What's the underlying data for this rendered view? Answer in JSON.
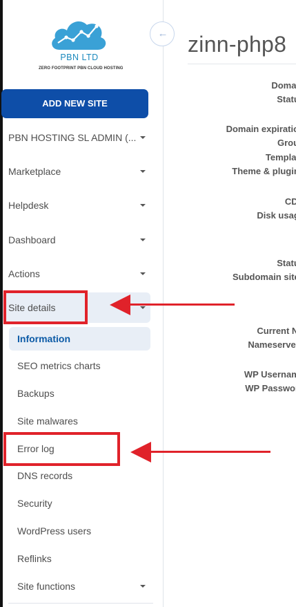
{
  "logo": {
    "title": "PBN LTD",
    "tagline": "ZERO FOOTPRINT PBN CLOUD HOSTING"
  },
  "sidebar": {
    "add_button": "ADD NEW SITE",
    "menu": [
      {
        "label": "PBN HOSTING SL ADMIN (..."
      },
      {
        "label": "Marketplace"
      },
      {
        "label": "Helpdesk"
      },
      {
        "label": "Dashboard"
      },
      {
        "label": "Actions"
      },
      {
        "label": "Site details"
      }
    ],
    "sub_menu": [
      {
        "label": "Information"
      },
      {
        "label": "SEO metrics charts"
      },
      {
        "label": "Backups"
      },
      {
        "label": "Site malwares"
      },
      {
        "label": "Error log"
      },
      {
        "label": "DNS records"
      },
      {
        "label": "Security"
      },
      {
        "label": "WordPress users"
      },
      {
        "label": "Reflinks"
      },
      {
        "label": "Site functions"
      }
    ]
  },
  "header": {
    "collapse_icon": "←",
    "title": "zinn-php8"
  },
  "details": {
    "labels": [
      "Domain",
      "Status",
      "Domain expiration",
      "Group",
      "Template",
      "Theme & plugins",
      "CDN",
      "Disk usage",
      "Status",
      "Subdomain sites",
      "Current NS",
      "Nameservers",
      "WP Username",
      "WP Password"
    ]
  },
  "colors": {
    "accent": "#0e4ea8",
    "annotation": "#e0222a",
    "active": "#0b5aa6"
  }
}
